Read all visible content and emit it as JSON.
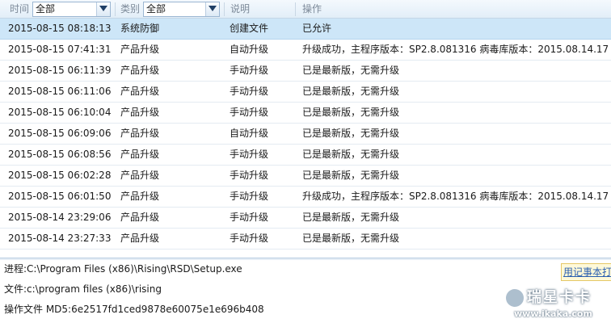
{
  "filters": {
    "time_label": "时间",
    "time_value": "全部",
    "category_label": "类别",
    "category_value": "全部",
    "desc_label": "说明",
    "action_label": "操作"
  },
  "rows": [
    {
      "time": "2015-08-15 08:18:13",
      "category": "系统防御",
      "desc": "创建文件",
      "action": "已允许"
    },
    {
      "time": "2015-08-15 07:41:31",
      "category": "产品升级",
      "desc": "自动升级",
      "action": "升级成功，主程序版本：SP2.8.081316 病毒库版本：2015.08.14.17"
    },
    {
      "time": "2015-08-15 06:11:39",
      "category": "产品升级",
      "desc": "手动升级",
      "action": "已是最新版，无需升级"
    },
    {
      "time": "2015-08-15 06:11:06",
      "category": "产品升级",
      "desc": "手动升级",
      "action": "已是最新版，无需升级"
    },
    {
      "time": "2015-08-15 06:10:04",
      "category": "产品升级",
      "desc": "手动升级",
      "action": "已是最新版，无需升级"
    },
    {
      "time": "2015-08-15 06:09:06",
      "category": "产品升级",
      "desc": "自动升级",
      "action": "已是最新版，无需升级"
    },
    {
      "time": "2015-08-15 06:08:56",
      "category": "产品升级",
      "desc": "手动升级",
      "action": "已是最新版，无需升级"
    },
    {
      "time": "2015-08-15 06:02:28",
      "category": "产品升级",
      "desc": "手动升级",
      "action": "已是最新版，无需升级"
    },
    {
      "time": "2015-08-15 06:01:50",
      "category": "产品升级",
      "desc": "手动升级",
      "action": "升级成功，主程序版本：SP2.8.081316 病毒库版本：2015.08.14.17"
    },
    {
      "time": "2015-08-14 23:29:06",
      "category": "产品升级",
      "desc": "手动升级",
      "action": "已是最新版，无需升级"
    },
    {
      "time": "2015-08-14 23:27:33",
      "category": "产品升级",
      "desc": "手动升级",
      "action": "已是最新版，无需升级"
    }
  ],
  "details": {
    "process": "进程:C:\\Program Files (x86)\\Rising\\RSD\\Setup.exe",
    "file": "文件:c:\\program files (x86)\\rising",
    "md5": "操作文件 MD5:6e2517fd1ced9878e60075e1e696b408",
    "notepad_button": "用记事本打开"
  },
  "watermark": {
    "title": "瑞星卡卡",
    "url": "www.ikaka.com"
  },
  "icons": {
    "combo_arrow": "chevron-down-icon",
    "watermark_logo": "rising-logo-icon"
  },
  "colors": {
    "selected_row": "#cde6f8",
    "header_text": "#7d8a99",
    "link_text": "#2a5fb0",
    "notepad_button_bg": "#fff9d9"
  }
}
